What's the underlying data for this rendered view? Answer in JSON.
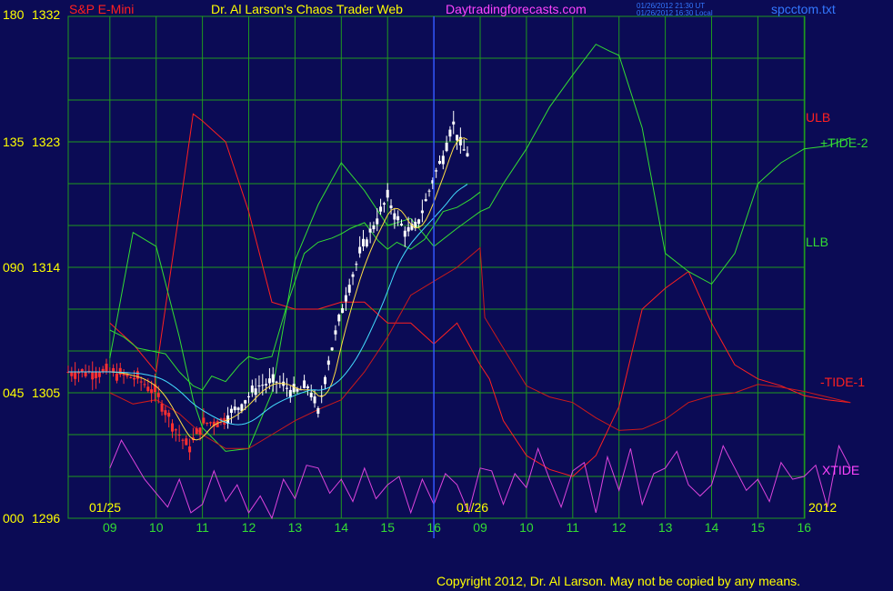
{
  "header": {
    "symbol": "S&P E-Mini",
    "title": "Dr. Al Larson's Chaos Trader Web",
    "site": "Daytradingforecasts.com",
    "timestamp_ut": "01/26/2012 21:30 UT",
    "timestamp_local": "01/26/2012 16:30 Local",
    "filename": "spcctom.txt"
  },
  "left_axis": [
    {
      "osc": "180",
      "price": "1332"
    },
    {
      "osc": "135",
      "price": "1323"
    },
    {
      "osc": "090",
      "price": "1314"
    },
    {
      "osc": "045",
      "price": "1305"
    },
    {
      "osc": "000",
      "price": "1296"
    }
  ],
  "right_labels": {
    "ulb": "ULB",
    "tide2": "+TIDE-2",
    "llb": "LLB",
    "tide1": "-TIDE-1",
    "xtide": "XTIDE"
  },
  "dates": {
    "d1": "01/25",
    "d2": "01/26",
    "year": "2012"
  },
  "hours": [
    "09",
    "10",
    "11",
    "12",
    "13",
    "14",
    "15",
    "16",
    "09",
    "10",
    "11",
    "12",
    "13",
    "14",
    "15",
    "16"
  ],
  "copyright": "Copyright 2012, Dr. Al Larson. May not be copied by any means.",
  "colors": {
    "background": "#0b0b55",
    "grid": "#1f9a1f",
    "ulb": "#ff2020",
    "tide2": "#33dd33",
    "llb": "#33dd33",
    "tide1": "#cc1a1a",
    "xtide": "#dd44dd",
    "price": "#ffffff",
    "avg_fast": "#ffdd44",
    "avg_slow": "#44ddff",
    "cursor": "#3355ff",
    "axis_text": "#ffff00",
    "symbol_text": "#ff2020",
    "site_text": "#ff44ff",
    "filename_text": "#3377ff"
  },
  "chart_data": {
    "type": "line",
    "title": "Dr. Al Larson's Chaos Trader Web",
    "x_label": "",
    "y_label": "",
    "x_ticks": [
      "09",
      "10",
      "11",
      "12",
      "13",
      "14",
      "15",
      "16",
      "09",
      "10",
      "11",
      "12",
      "13",
      "14",
      "15",
      "16"
    ],
    "y_ticks_price": [
      1296,
      1305,
      1314,
      1323,
      1332
    ],
    "y_ticks_osc": [
      0,
      45,
      90,
      135,
      180
    ],
    "ylim_price": [
      1296,
      1332
    ],
    "ylim_osc": [
      0,
      180
    ],
    "grid": true,
    "series": [
      {
        "name": "ULB",
        "axis": "price",
        "x": [
          0,
          0.5,
          1,
          1.5,
          1.8,
          2,
          2.5,
          3,
          3.5,
          4,
          4.5,
          5,
          5.5,
          6,
          6.5,
          7,
          7.5,
          8.0,
          8.2,
          8.5,
          9,
          9.5,
          10,
          10.5,
          11,
          11.5,
          12,
          12.5,
          13,
          13.5,
          14,
          14.5,
          15,
          15.5,
          16
        ],
        "y": [
          1310,
          1308.5,
          1306.5,
          1318,
          1325,
          1324.5,
          1323,
          1318,
          1311.5,
          1311,
          1311,
          1311.5,
          1311.5,
          1310,
          1310,
          1308.5,
          1310,
          1307,
          1306,
          1303,
          1300.5,
          1299.5,
          1299,
          1300.5,
          1304,
          1311,
          1312.5,
          1313.7,
          1310,
          1307,
          1306,
          1305.5,
          1304.8,
          1304.5,
          1304.3
        ]
      },
      {
        "name": "+TIDE-2",
        "axis": "price",
        "x": [
          0,
          0.5,
          1,
          1.5,
          1.8,
          2,
          2.5,
          3,
          3.5,
          4,
          4.5,
          5,
          5.5,
          6,
          6.5,
          7,
          7.5,
          8,
          8.2,
          8.5,
          9,
          9.5,
          10,
          10.5,
          10.8,
          11,
          11.5,
          12,
          12.5,
          13,
          13.5,
          14,
          14.5,
          15,
          15.5,
          16
        ],
        "y": [
          1307.5,
          1316.5,
          1315.5,
          1309,
          1304.5,
          1302.5,
          1300.8,
          1301,
          1305,
          1314.5,
          1318.5,
          1321.5,
          1319.5,
          1317,
          1317.5,
          1315.5,
          1316.8,
          1318,
          1318.3,
          1320,
          1322.5,
          1325.5,
          1327.8,
          1330,
          1329.5,
          1329.2,
          1324,
          1315,
          1313.7,
          1312.8,
          1315,
          1320,
          1321.5,
          1322.5,
          1322.7,
          1323.3
        ]
      },
      {
        "name": "LLB",
        "axis": "price",
        "x": [
          0,
          0.3,
          0.6,
          0.9,
          1.2,
          1.5,
          1.8,
          2.0,
          2.2,
          2.5,
          2.8,
          3.0,
          3.2,
          3.5,
          3.8,
          4.0,
          4.2,
          4.5,
          4.8,
          5.0,
          5.2,
          5.5,
          5.8,
          6.0,
          6.2,
          6.5,
          6.8,
          7.0,
          7.2,
          7.5,
          7.8,
          8.0
        ],
        "y": [
          1309.5,
          1309,
          1308.2,
          1308,
          1307.8,
          1306.5,
          1305.5,
          1305.2,
          1306.2,
          1305.8,
          1307,
          1307.6,
          1307.4,
          1307.6,
          1311,
          1313,
          1315,
          1315.8,
          1316.1,
          1316.4,
          1316.8,
          1317.2,
          1315.9,
          1315.3,
          1315.8,
          1315.3,
          1316,
          1317,
          1318,
          1318.3,
          1318.9,
          1319.4
        ]
      },
      {
        "name": "-TIDE-1",
        "axis": "price",
        "x": [
          0,
          0.5,
          1,
          1.5,
          2,
          2.5,
          3,
          3.5,
          4,
          4.5,
          5,
          5.5,
          6,
          6.5,
          7,
          7.5,
          8.0,
          8.1,
          8.5,
          9,
          9.5,
          10,
          10.5,
          11,
          11.5,
          12,
          12.5,
          13,
          13.5,
          14,
          14.5,
          15,
          15.5,
          16
        ],
        "y": [
          1305,
          1304.2,
          1304.5,
          1303.5,
          1302,
          1301,
          1301,
          1302,
          1303,
          1303.8,
          1304.5,
          1306.5,
          1309,
          1312,
          1313,
          1314,
          1315.4,
          1310.4,
          1308.2,
          1305.5,
          1304.7,
          1304.3,
          1303.2,
          1302.3,
          1302.4,
          1303.1,
          1304.3,
          1304.8,
          1305,
          1305.6,
          1305.4,
          1305.1,
          1304.7,
          1304.3
        ]
      },
      {
        "name": "XTIDE",
        "axis": "osc",
        "x": [
          0,
          0.25,
          0.5,
          0.75,
          1,
          1.25,
          1.5,
          1.75,
          2,
          2.25,
          2.5,
          2.75,
          3,
          3.25,
          3.5,
          3.75,
          4,
          4.25,
          4.5,
          4.75,
          5,
          5.25,
          5.5,
          5.75,
          6,
          6.25,
          6.5,
          6.75,
          7,
          7.25,
          7.5,
          7.75,
          8,
          8.25,
          8.5,
          8.75,
          9,
          9.25,
          9.5,
          9.75,
          10,
          10.25,
          10.5,
          10.75,
          11,
          11.25,
          11.5,
          11.75,
          12,
          12.25,
          12.5,
          12.75,
          13,
          13.25,
          13.5,
          13.75,
          14,
          14.25,
          14.5,
          14.75,
          15,
          15.25,
          15.5,
          15.75,
          16
        ],
        "y": [
          18,
          28,
          21,
          14,
          9,
          4,
          14,
          2,
          5,
          17,
          6,
          12,
          2,
          8,
          0,
          14,
          7,
          19,
          18,
          9,
          14,
          6,
          18,
          7,
          12,
          15,
          2,
          14,
          5,
          16,
          12,
          2,
          18,
          17,
          5,
          16,
          11,
          25,
          14,
          4,
          17,
          20,
          2,
          22,
          10,
          25,
          5,
          16,
          18,
          24,
          12,
          8,
          12,
          26,
          18,
          10,
          14,
          6,
          20,
          14,
          15,
          19,
          4,
          26,
          18
        ]
      }
    ],
    "ohlc_summary": {
      "start": 1306.5,
      "end": 1322,
      "low": 1299.8,
      "high": 1325
    }
  }
}
